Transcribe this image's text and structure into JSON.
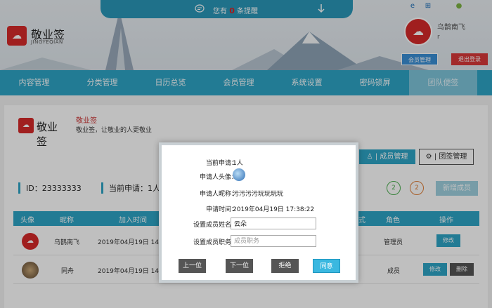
{
  "header": {
    "notice_prefix": "您有",
    "notice_count": "0",
    "notice_suffix": "条提醒",
    "logo_name": "敬业签",
    "logo_sub": "JINGYEQIAN",
    "username": "乌鹊南飞",
    "user_status": "r",
    "member_button": "会员管理",
    "logout_button": "退出登录",
    "os_icons": [
      "ie-icon",
      "windows-icon",
      "apple-icon",
      "android-icon"
    ]
  },
  "nav": {
    "items": [
      "内容管理",
      "分类管理",
      "日历总览",
      "会员管理",
      "系统设置",
      "密码锁屏",
      "团队便签"
    ],
    "active_index": 6
  },
  "team": {
    "logo_text": "敬业签",
    "title": "敬业签",
    "desc": "敬业签，让敬业的人更敬业",
    "member_mgr_button": "成员管理",
    "team_mgr_button": "团签管理",
    "id_label": "ID：23333333",
    "current_label": "当前申请：1人",
    "circle1": "2",
    "circle2": "2",
    "new_member_button": "新增成员"
  },
  "table": {
    "headers": [
      "头像",
      "昵称",
      "加入时间",
      "式",
      "角色",
      "操作"
    ],
    "rows": [
      {
        "name": "乌鹊南飞",
        "time": "2019年04月19日 14:",
        "role": "管理员",
        "edit": "修改"
      },
      {
        "name": "同舟",
        "time": "2019年04月19日 14:",
        "role": "成员",
        "edit": "修改",
        "del": "删除"
      }
    ]
  },
  "dialog": {
    "current_label": "当前申请：",
    "current_value": "1人",
    "avatar_label": "申请人头像：",
    "nick_label": "申请人昵称：",
    "nick_value": "污污污污玩玩玩玩",
    "time_label": "申请时间：",
    "time_value": "2019年04月19日 17:38:22",
    "name_label": "设置成员姓名：",
    "name_value": "云朵",
    "role_label": "设置成员职务：",
    "role_placeholder": "成员职务",
    "prev_button": "上一位",
    "next_button": "下一位",
    "reject_button": "拒绝",
    "accept_button": "同意"
  },
  "colors": {
    "accent": "#2ea4c6",
    "brand": "#d62a2a",
    "danger": "#d9383a"
  }
}
